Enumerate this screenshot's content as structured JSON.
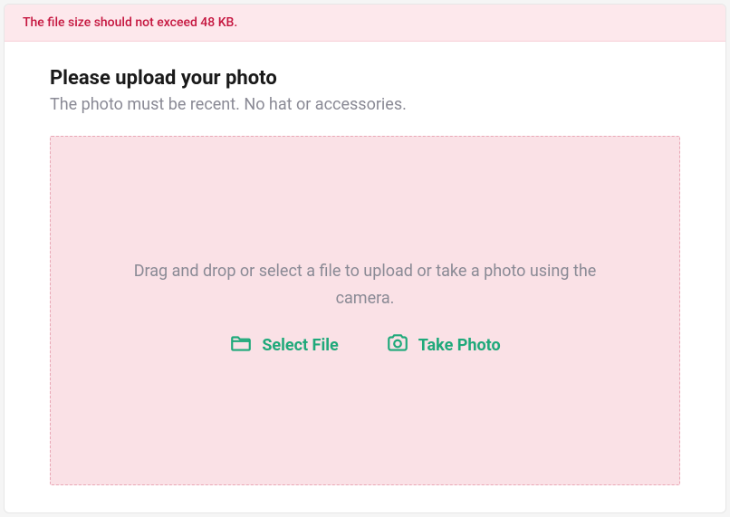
{
  "error": {
    "message": "The file size should not exceed 48 KB."
  },
  "header": {
    "title": "Please upload your photo",
    "subtitle": "The photo must be recent. No hat or accessories."
  },
  "dropzone": {
    "instruction": "Drag and drop or select a file to upload or take a photo using the camera.",
    "select_file_label": "Select File",
    "take_photo_label": "Take Photo"
  }
}
